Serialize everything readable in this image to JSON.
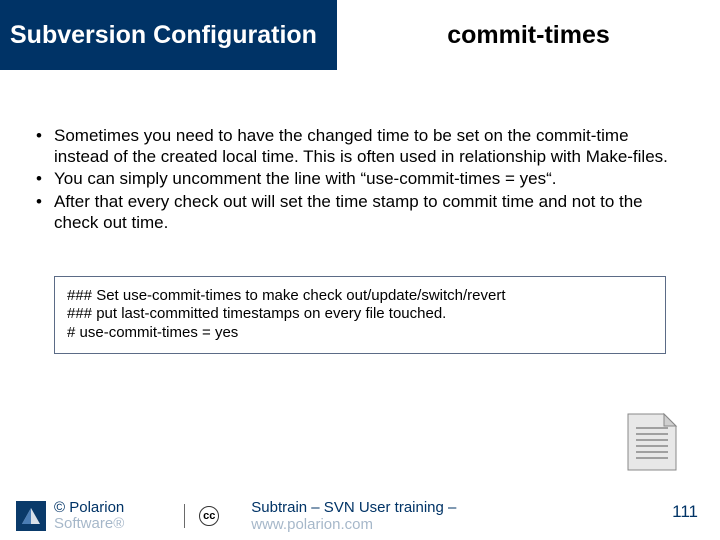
{
  "header": {
    "left": "Subversion Configuration",
    "right": "commit-times"
  },
  "bullets": [
    "Sometimes you need to have the changed time to be set on the commit-time instead of the created local time. This is often used in relationship with Make-files.",
    "You can simply uncomment the line with “use-commit-times = yes“.",
    "After that every check out will set the time stamp to commit time and not to the check out time."
  ],
  "code": {
    "line1": "### Set use-commit-times to make check out/update/switch/revert",
    "line2": "### put last-committed timestamps on every file touched.",
    "line3": "# use-commit-times = yes"
  },
  "footer": {
    "copyright": "© Polarion",
    "copyright2": "Software®",
    "cc": "cc",
    "training": "Subtrain – SVN User training –",
    "training2": "www.polarion.com",
    "page": "111"
  }
}
